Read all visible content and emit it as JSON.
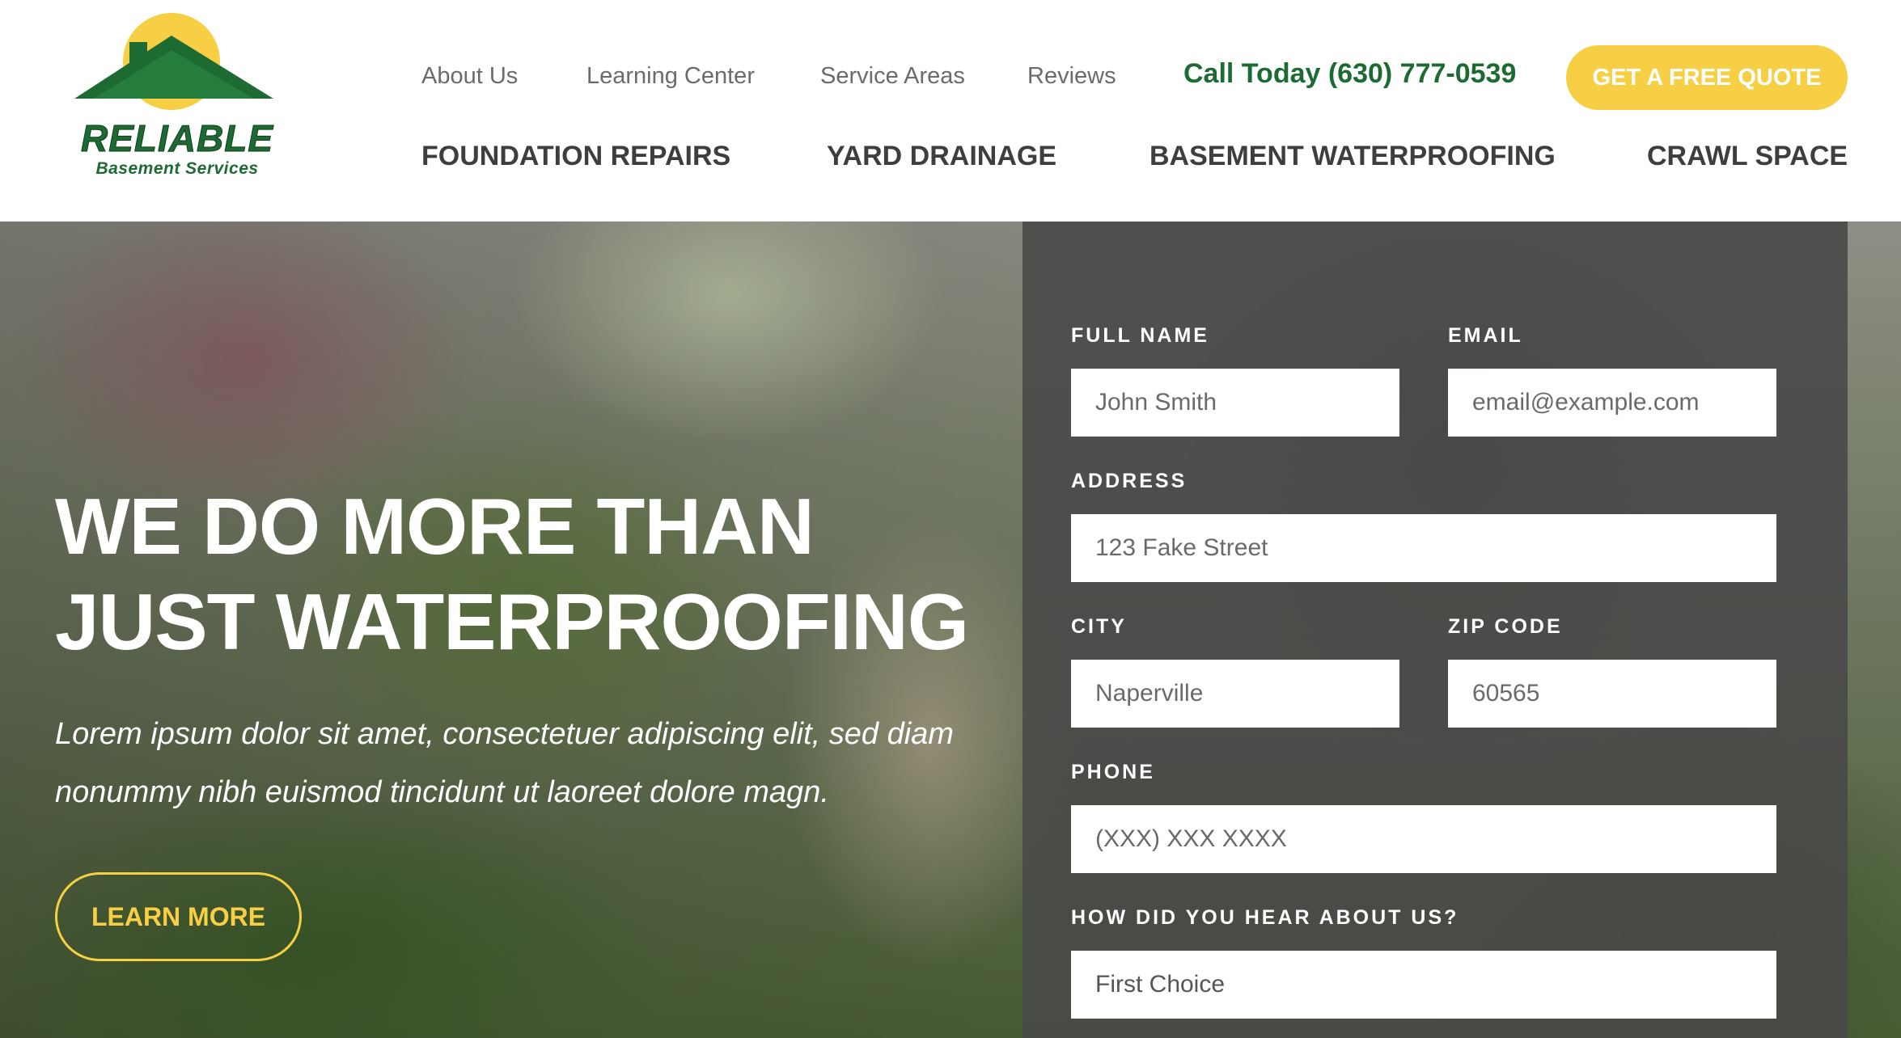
{
  "logo": {
    "name": "RELIABLE",
    "tagline": "Basement Services",
    "colors": {
      "sun": "#f7cf45",
      "roof": "#1d6b33"
    }
  },
  "nav": {
    "secondary": [
      {
        "label": "About Us"
      },
      {
        "label": "Learning Center"
      },
      {
        "label": "Service Areas"
      },
      {
        "label": "Reviews"
      }
    ],
    "call": "Call Today (630) 777-0539",
    "quote_button": "GET A FREE QUOTE",
    "primary": [
      {
        "label": "FOUNDATION REPAIRS"
      },
      {
        "label": "YARD DRAINAGE"
      },
      {
        "label": "BASEMENT WATERPROOFING"
      },
      {
        "label": "CRAWL SPACE"
      }
    ]
  },
  "hero": {
    "title_line1": "WE DO MORE THAN",
    "title_line2": "JUST WATERPROOFING",
    "subtitle": "Lorem ipsum dolor sit amet, consectetuer adipiscing elit, sed diam nonummy nibh euismod tincidunt ut laoreet dolore magn.",
    "cta": "LEARN MORE"
  },
  "form": {
    "full_name": {
      "label": "FULL NAME",
      "placeholder": "John Smith"
    },
    "email": {
      "label": "EMAIL",
      "placeholder": "email@example.com"
    },
    "address": {
      "label": "ADDRESS",
      "placeholder": "123 Fake Street"
    },
    "city": {
      "label": "CITY",
      "placeholder": "Naperville"
    },
    "zip": {
      "label": "ZIP CODE",
      "placeholder": "60565"
    },
    "phone": {
      "label": "PHONE",
      "placeholder": "(XXX) XXX XXXX"
    },
    "referral": {
      "label": "HOW DID YOU HEAR ABOUT US?",
      "selected": "First Choice"
    }
  },
  "colors": {
    "brand_green": "#1d6b33",
    "accent_yellow": "#f7cf45",
    "form_panel": "#484848"
  }
}
